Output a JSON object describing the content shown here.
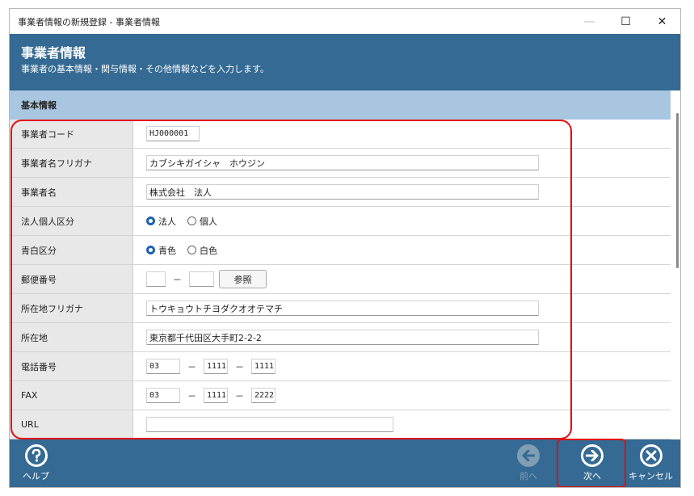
{
  "window": {
    "title": "事業者情報の新規登録 - 事業者情報",
    "minimize_glyph": "—",
    "maximize_glyph": "☐",
    "close_glyph": "✕"
  },
  "header": {
    "title": "事業者情報",
    "description": "事業者の基本情報・関与情報・その他情報などを入力します。"
  },
  "section": {
    "title": "基本情報"
  },
  "fields": {
    "code": {
      "label": "事業者コード",
      "value": "HJ000001"
    },
    "name_kana": {
      "label": "事業者名フリガナ",
      "value": "カブシキガイシャ　ホウジン"
    },
    "name": {
      "label": "事業者名",
      "value": "株式会社　法人"
    },
    "entity_type": {
      "label": "法人個人区分",
      "options": [
        "法人",
        "個人"
      ],
      "selected": "法人"
    },
    "blue_white": {
      "label": "青白区分",
      "options": [
        "青色",
        "白色"
      ],
      "selected": "青色"
    },
    "postal": {
      "label": "郵便番号",
      "part1": "",
      "part2": "",
      "separator": "－",
      "button": "参照"
    },
    "address_kana": {
      "label": "所在地フリガナ",
      "value": "トウキョウトチヨダクオオテマチ"
    },
    "address": {
      "label": "所在地",
      "value": "東京都千代田区大手町2-2-2"
    },
    "phone": {
      "label": "電話番号",
      "part1": "03",
      "part2": "1111",
      "part3": "1111",
      "separator": "－"
    },
    "fax": {
      "label": "FAX",
      "part1": "03",
      "part2": "1111",
      "part3": "2222",
      "separator": "－"
    },
    "url": {
      "label": "URL",
      "value": ""
    }
  },
  "footer": {
    "help_label": "ヘルプ",
    "prev_label": "前へ",
    "next_label": "次へ",
    "cancel_label": "キャンセル"
  },
  "colors": {
    "header_bg": "#346a93",
    "section_bg": "#a8c6e0",
    "highlight": "#e01010",
    "radio_checked": "#1e62b0"
  },
  "icons": {
    "help": "question-circle-icon",
    "prev": "arrow-left-circle-icon",
    "next": "arrow-right-circle-icon",
    "cancel": "x-circle-icon"
  }
}
